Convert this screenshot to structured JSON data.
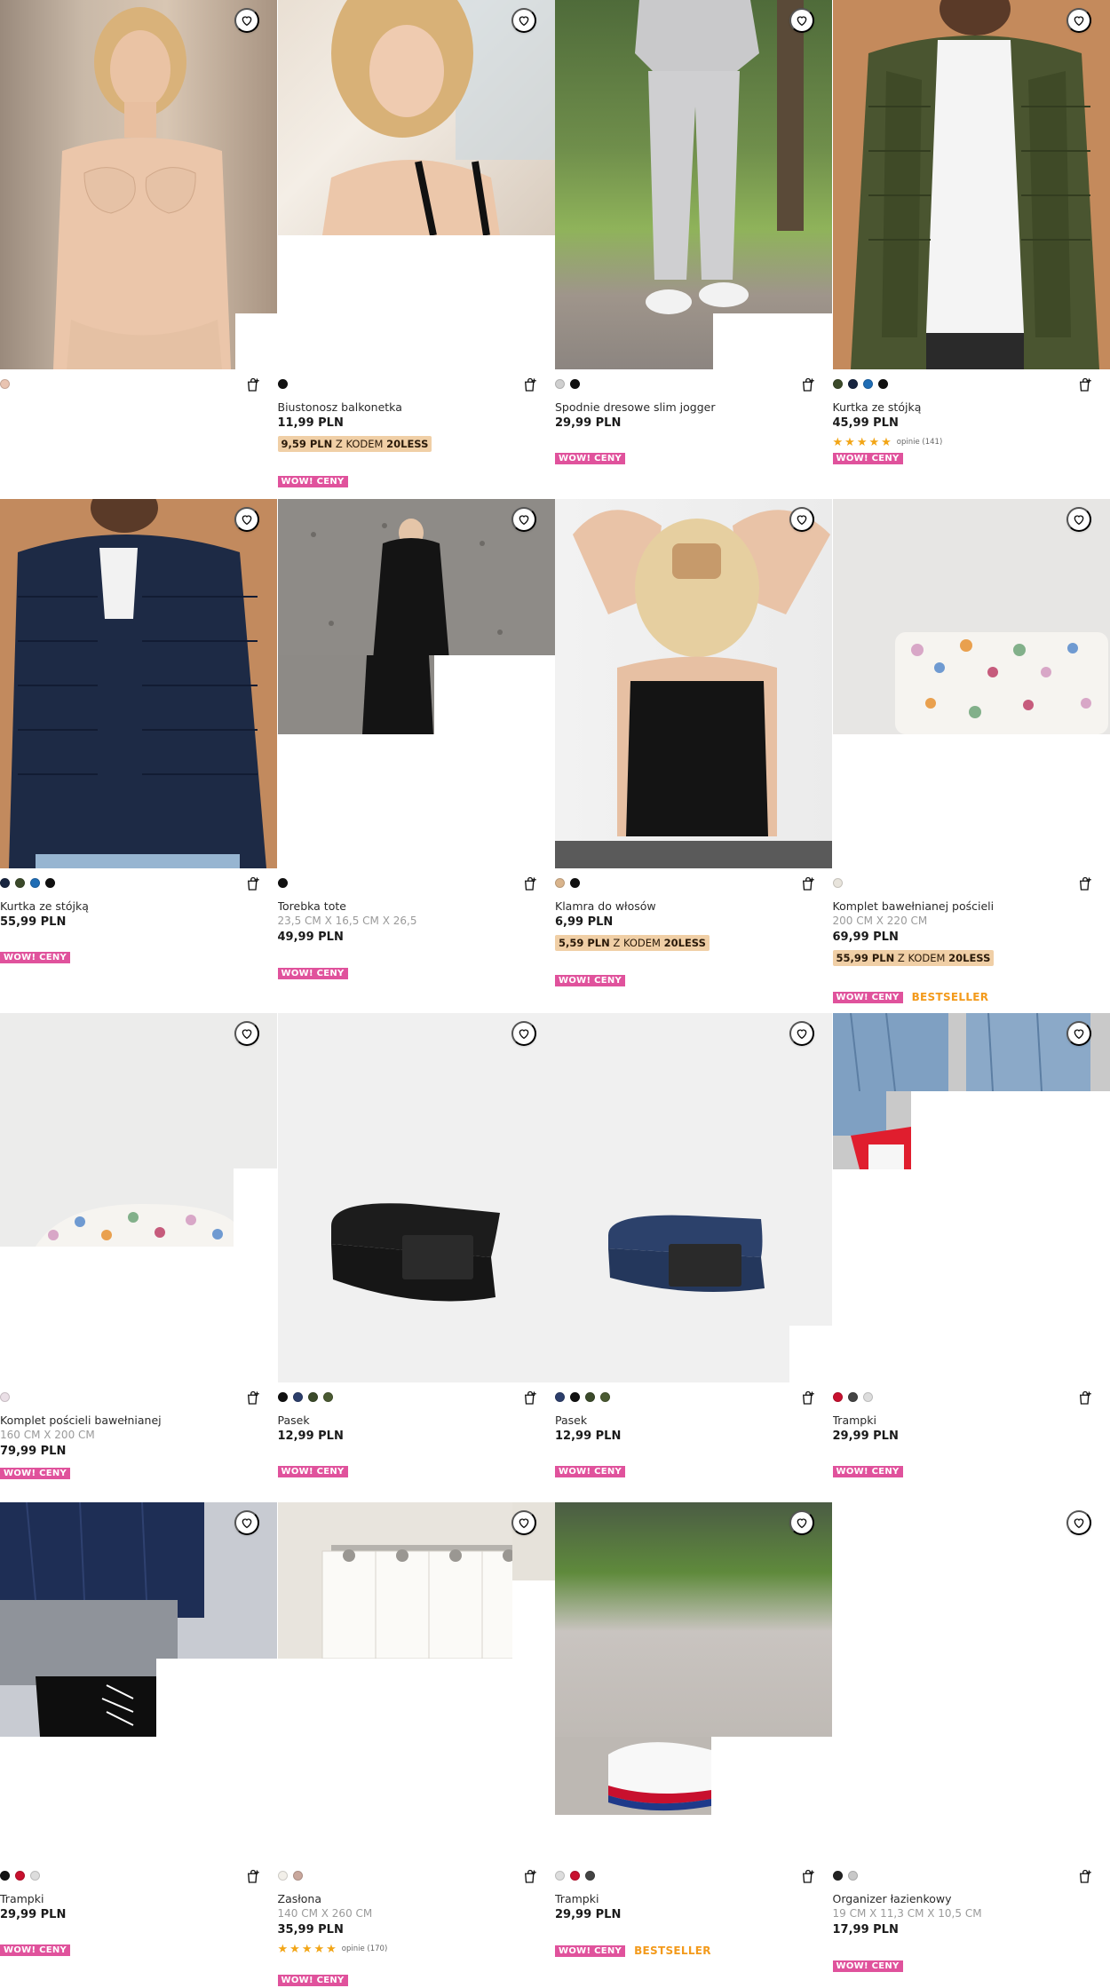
{
  "products": [
    {
      "name": "",
      "dims": "",
      "price": "",
      "promo_price": "",
      "promo_text": "",
      "promo_code": "",
      "rating_count": "",
      "wow": "",
      "bestseller": "",
      "swatches": [
        "#e9c4b1"
      ]
    },
    {
      "name": "Biustonosz balkonetka",
      "dims": "",
      "price": "11,99 PLN",
      "promo_price": "9,59 PLN",
      "promo_text": " Z KODEM ",
      "promo_code": "20LESS",
      "rating_count": "",
      "wow": "WOW! CENY",
      "bestseller": "",
      "swatches": [
        "#111111"
      ]
    },
    {
      "name": "Spodnie dresowe slim jogger",
      "dims": "",
      "price": "29,99 PLN",
      "promo_price": "",
      "promo_text": "",
      "promo_code": "",
      "rating_count": "",
      "wow": "WOW! CENY",
      "bestseller": "",
      "swatches": [
        "#cfcfcf",
        "#111111"
      ]
    },
    {
      "name": "Kurtka ze stójką",
      "dims": "",
      "price": "45,99 PLN",
      "promo_price": "",
      "promo_text": "",
      "promo_code": "",
      "rating_count": "opinie (141)",
      "wow": "WOW! CENY",
      "bestseller": "",
      "swatches": [
        "#3b4a2a",
        "#17243f",
        "#1f6db5",
        "#111111"
      ]
    },
    {
      "name": "Kurtka ze stójką",
      "dims": "",
      "price": "55,99 PLN",
      "promo_price": "",
      "promo_text": "",
      "promo_code": "",
      "rating_count": "",
      "wow": "WOW! CENY",
      "bestseller": "",
      "swatches": [
        "#17243f",
        "#3b4a2a",
        "#1f6db5",
        "#111111"
      ]
    },
    {
      "name": "Torebka tote",
      "dims": "23,5 CM X 16,5 CM X 26,5",
      "price": "49,99 PLN",
      "promo_price": "",
      "promo_text": "",
      "promo_code": "",
      "rating_count": "",
      "wow": "WOW! CENY",
      "bestseller": "",
      "swatches": [
        "#111111"
      ]
    },
    {
      "name": "Klamra do włosów",
      "dims": "",
      "price": "6,99 PLN",
      "promo_price": "5,59 PLN",
      "promo_text": " Z KODEM ",
      "promo_code": "20LESS",
      "rating_count": "",
      "wow": "WOW! CENY",
      "bestseller": "",
      "swatches": [
        "#d9b48c",
        "#111111"
      ]
    },
    {
      "name": "Komplet bawełnianej pościeli",
      "dims": "200 CM X 220 CM",
      "price": "69,99 PLN",
      "promo_price": "55,99 PLN",
      "promo_text": " Z KODEM ",
      "promo_code": "20LESS",
      "rating_count": "",
      "wow": "WOW! CENY",
      "bestseller": "BESTSELLER",
      "swatches": [
        "#e8e4dc"
      ]
    },
    {
      "name": "Komplet pościeli bawełnianej",
      "dims": "160 CM X 200 CM",
      "price": "79,99 PLN",
      "promo_price": "",
      "promo_text": "",
      "promo_code": "",
      "rating_count": "",
      "wow": "WOW! CENY",
      "bestseller": "",
      "swatches": [
        "#eadfe6"
      ]
    },
    {
      "name": "Pasek",
      "dims": "",
      "price": "12,99 PLN",
      "promo_price": "",
      "promo_text": "",
      "promo_code": "",
      "rating_count": "",
      "wow": "WOW! CENY",
      "bestseller": "",
      "swatches": [
        "#111111",
        "#2c3e6b",
        "#3b4a2a",
        "#4a5a32"
      ]
    },
    {
      "name": "Pasek",
      "dims": "",
      "price": "12,99 PLN",
      "promo_price": "",
      "promo_text": "",
      "promo_code": "",
      "rating_count": "",
      "wow": "WOW! CENY",
      "bestseller": "",
      "swatches": [
        "#2c3e6b",
        "#111111",
        "#3b4a2a",
        "#4a5a32"
      ]
    },
    {
      "name": "Trampki",
      "dims": "",
      "price": "29,99 PLN",
      "promo_price": "",
      "promo_text": "",
      "promo_code": "",
      "rating_count": "",
      "wow": "WOW! CENY",
      "bestseller": "",
      "swatches": [
        "#c8102e",
        "#444444",
        "#dddddd"
      ]
    },
    {
      "name": "Trampki",
      "dims": "",
      "price": "29,99 PLN",
      "promo_price": "",
      "promo_text": "",
      "promo_code": "",
      "rating_count": "",
      "wow": "WOW! CENY",
      "bestseller": "",
      "swatches": [
        "#111111",
        "#c8102e",
        "#dddddd"
      ]
    },
    {
      "name": "Zasłona",
      "dims": "140 CM X 260 CM",
      "price": "35,99 PLN",
      "promo_price": "",
      "promo_text": "",
      "promo_code": "",
      "rating_count": "opinie (170)",
      "wow": "WOW! CENY",
      "bestseller": "",
      "swatches": [
        "#f2efe9",
        "#c9a79c"
      ]
    },
    {
      "name": "Trampki",
      "dims": "",
      "price": "29,99 PLN",
      "promo_price": "",
      "promo_text": "",
      "promo_code": "",
      "rating_count": "",
      "wow": "WOW! CENY",
      "bestseller": "BESTSELLER",
      "swatches": [
        "#dddddd",
        "#c8102e",
        "#444444"
      ]
    },
    {
      "name": "Organizer łazienkowy",
      "dims": "19 CM X 11,3 CM X 10,5 CM",
      "price": "17,99 PLN",
      "promo_price": "",
      "promo_text": "",
      "promo_code": "",
      "rating_count": "",
      "wow": "WOW! CENY",
      "bestseller": "",
      "swatches": [
        "#222222",
        "#c8c8c8"
      ]
    }
  ],
  "colors": {
    "wow_badge": "#e0529c",
    "bestseller": "#f39a1b",
    "promo_bg": "#f0cfa6",
    "star": "#f2a516"
  },
  "icons": {
    "favorite": "heart-icon",
    "cart": "add-to-cart-icon",
    "star": "star-icon"
  },
  "rating_stars": 5
}
